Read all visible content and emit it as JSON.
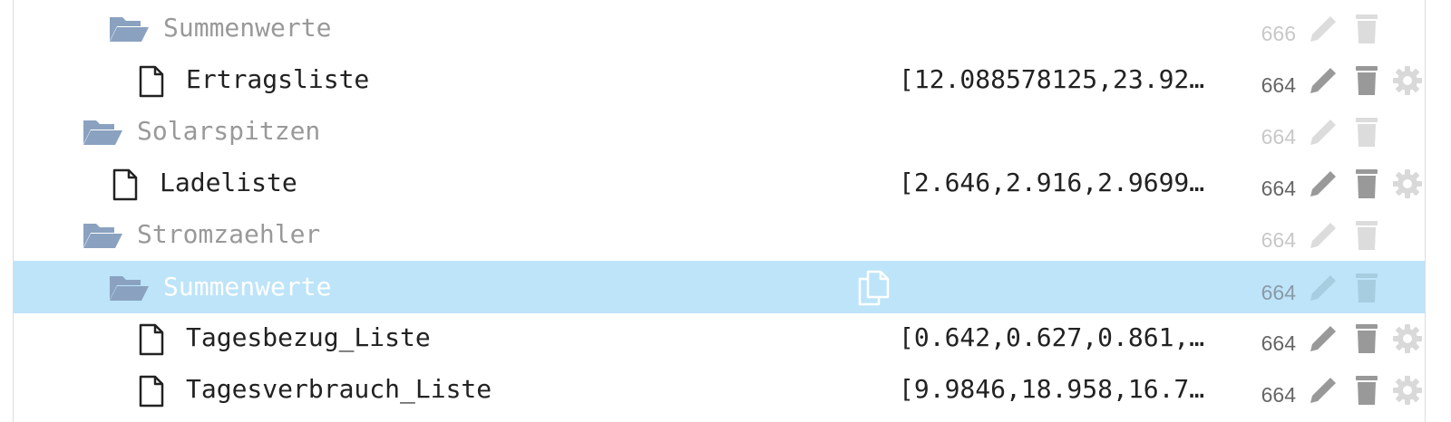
{
  "colors": {
    "folder_icon": "#8aa2c0",
    "folder_text": "#999999",
    "file_text": "#222222",
    "selected_row": "#bde4f9",
    "icon_active": "#999999",
    "icon_disabled": "#dcdcdc",
    "gear": "#d9d9d9"
  },
  "rows": [
    {
      "type": "folder",
      "name": "Summenwerte",
      "value": "",
      "acl": "666",
      "icons": [
        "folder-open-icon",
        "edit-icon",
        "delete-icon"
      ]
    },
    {
      "type": "file",
      "name": "Ertragsliste",
      "value": "[12.088578125,23.92…",
      "acl": "664",
      "icons": [
        "file-icon",
        "edit-icon",
        "delete-icon",
        "gear-icon"
      ]
    },
    {
      "type": "folder",
      "name": "Solarspitzen",
      "value": "",
      "acl": "664",
      "icons": [
        "folder-open-icon",
        "edit-icon",
        "delete-icon"
      ]
    },
    {
      "type": "file",
      "name": "Ladeliste",
      "value": "[2.646,2.916,2.9699…",
      "acl": "664",
      "icons": [
        "file-icon",
        "edit-icon",
        "delete-icon",
        "gear-icon"
      ]
    },
    {
      "type": "folder",
      "name": "Stromzaehler",
      "value": "",
      "acl": "664",
      "icons": [
        "folder-open-icon",
        "edit-icon",
        "delete-icon"
      ]
    },
    {
      "type": "folder",
      "name": "Summenwerte",
      "value": "",
      "acl": "664",
      "selected": true,
      "icons": [
        "folder-open-icon",
        "copy-icon",
        "edit-icon",
        "delete-icon"
      ]
    },
    {
      "type": "file",
      "name": "Tagesbezug_Liste",
      "value": "[0.642,0.627,0.861,…",
      "acl": "664",
      "icons": [
        "file-icon",
        "edit-icon",
        "delete-icon",
        "gear-icon"
      ]
    },
    {
      "type": "file",
      "name": "Tagesverbrauch_Liste",
      "value": "[9.9846,18.958,16.7…",
      "acl": "664",
      "icons": [
        "file-icon",
        "edit-icon",
        "delete-icon",
        "gear-icon"
      ]
    }
  ]
}
